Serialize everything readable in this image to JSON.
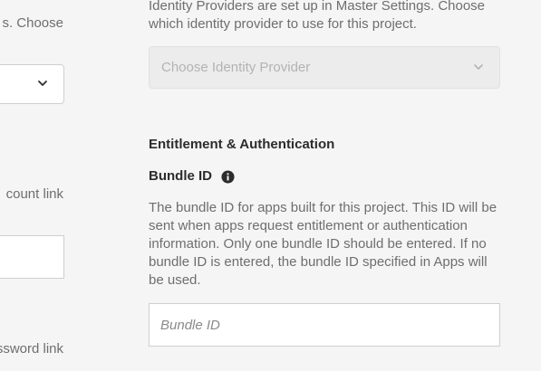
{
  "left_column": {
    "text_top": "s. Choose",
    "text_account": "count link",
    "text_password": "ssword link"
  },
  "identity_provider": {
    "help_line1": "Identity Providers are set up in Master Settings. Choose",
    "help_line2": "which identity provider to use for this project.",
    "select_placeholder": "Choose Identity Provider"
  },
  "entitlement": {
    "section_title": "Entitlement & Authentication",
    "bundle_label": "Bundle ID",
    "bundle_help": "The bundle ID for apps built for this project. This ID will be sent when apps request entitlement or authentication information. Only one bundle ID should be entered. If no bundle ID is entered, the bundle ID specified in Apps will be used.",
    "bundle_placeholder": "Bundle ID",
    "bundle_value": ""
  },
  "icons": {
    "chevron": "chevron-down-icon",
    "info": "info-icon"
  },
  "colors": {
    "background": "#f5f5f5",
    "text_primary": "#2c2c2c",
    "text_secondary": "#6e6e6e",
    "disabled_select_bg": "#ececec",
    "border": "#cfcfcf"
  }
}
